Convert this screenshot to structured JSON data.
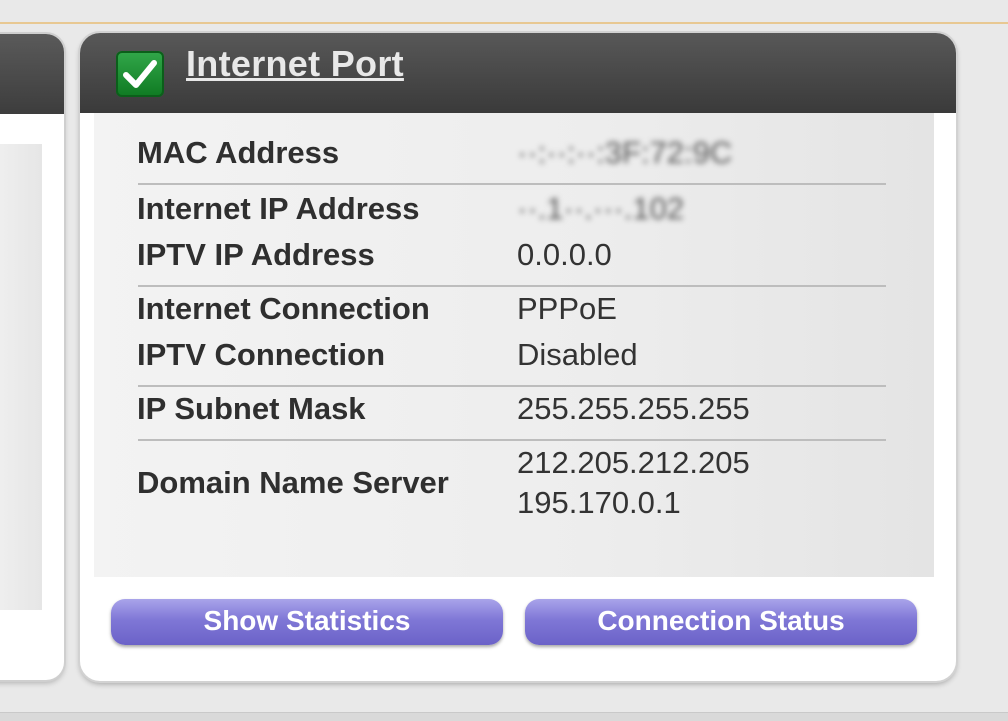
{
  "card": {
    "title": "Internet Port",
    "status_icon": "checkmark-icon"
  },
  "details": [
    {
      "label": "MAC Address",
      "value": "··:··:··:3F:72:9C",
      "redacted": true
    },
    {
      "label": "Internet IP Address",
      "value": "··.1··.···.102",
      "redacted": true
    },
    {
      "label": "IPTV IP Address",
      "value": "0.0.0.0"
    },
    {
      "label": "Internet Connection",
      "value": "PPPoE"
    },
    {
      "label": "IPTV Connection",
      "value": "Disabled"
    },
    {
      "label": "IP Subnet Mask",
      "value": "255.255.255.255"
    },
    {
      "label": "Domain Name Server",
      "values": [
        "212.205.212.205",
        "195.170.0.1"
      ]
    }
  ],
  "buttons": {
    "show_statistics": "Show Statistics",
    "connection_status": "Connection Status"
  },
  "colors": {
    "header_bg": "#4a4a4a",
    "check_green": "#1f8f33",
    "button_purple": "#7f77d6",
    "accent_rule": "#e8c892"
  }
}
